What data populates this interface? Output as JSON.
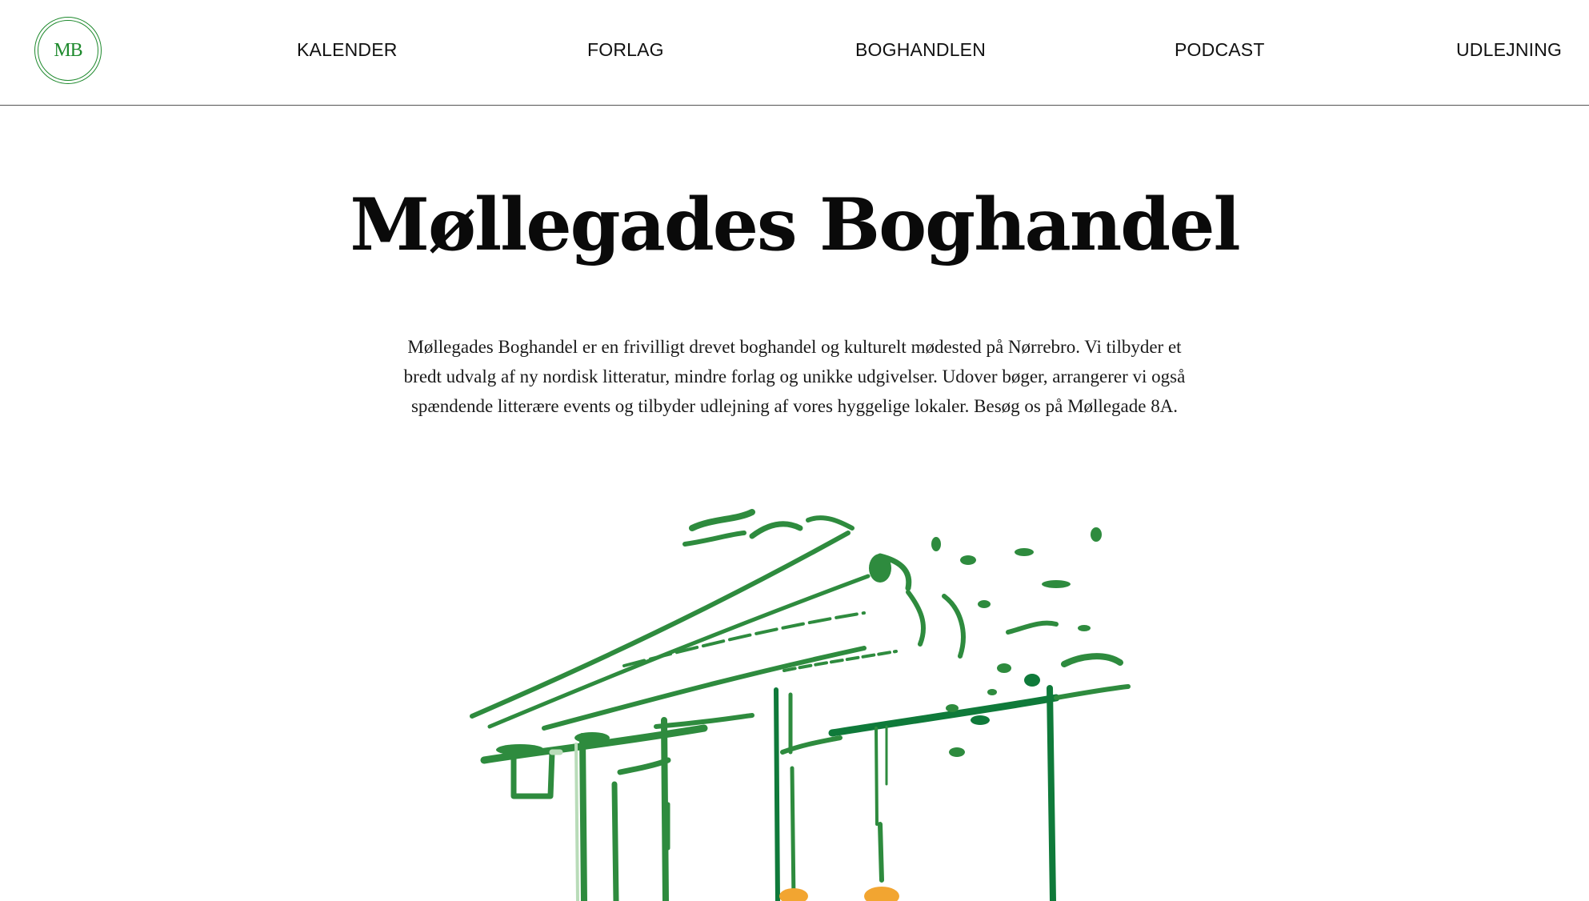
{
  "header": {
    "logo_text": "MB",
    "nav": [
      {
        "label": "KALENDER"
      },
      {
        "label": "FORLAG"
      },
      {
        "label": "BOGHANDLEN"
      },
      {
        "label": "PODCAST"
      },
      {
        "label": "UDLEJNING"
      }
    ]
  },
  "main": {
    "title": "Møllegades Boghandel",
    "intro": "Møllegades Boghandel er en frivilligt drevet boghandel og kulturelt mødested på Nørrebro. Vi tilbyder et bredt udvalg af ny nordisk litteratur, mindre forlag og unikke udgivelser. Udover bøger, arrangerer vi også spændende litterære events og tilbyder udlejning af vores hyggelige lokaler. Besøg os på Møllegade 8A."
  },
  "colors": {
    "brand_green": "#1f8a2e",
    "dark_green": "#0f7a3a",
    "light_green": "#b9dcb9",
    "lamp_orange": "#f2a531",
    "text": "#111111"
  },
  "illustration": {
    "icon": "storefront-sketch-icon"
  }
}
